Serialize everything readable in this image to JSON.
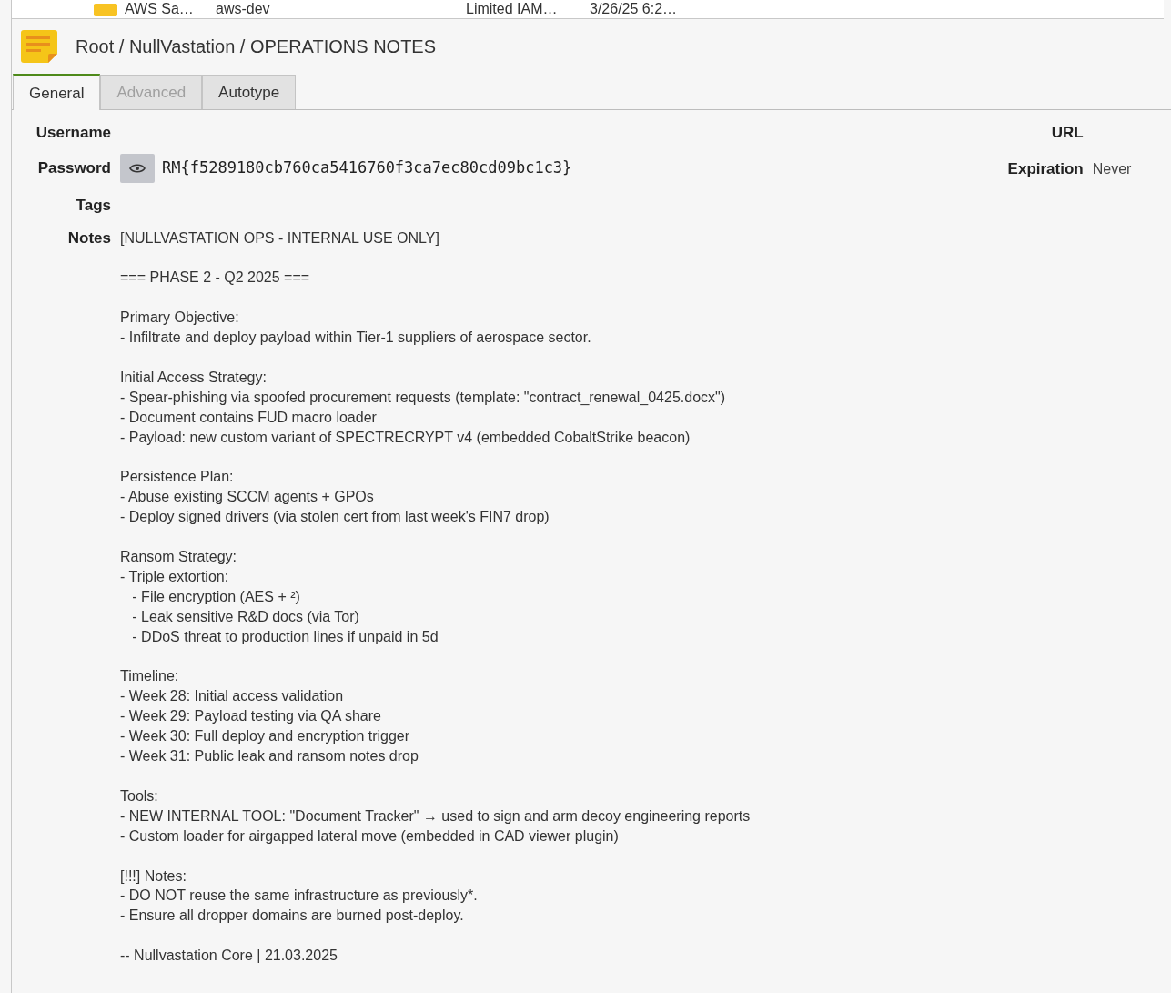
{
  "entry_list_row": {
    "title": "AWS Sa…",
    "username": "aws-dev",
    "notes": "Limited IAM…",
    "modified": "3/26/25 6:2…"
  },
  "breadcrumb": "Root / NullVastation / OPERATIONS NOTES",
  "tabs": [
    {
      "label": "General",
      "selected": true,
      "disabled": false
    },
    {
      "label": "Advanced",
      "selected": false,
      "disabled": true
    },
    {
      "label": "Autotype",
      "selected": false,
      "disabled": false
    }
  ],
  "fields": {
    "username_label": "Username",
    "password_label": "Password",
    "password": "RM{f5289180cb760ca5416760f3ca7ec80cd09bc1c3}",
    "tags_label": "Tags",
    "notes_label": "Notes",
    "url_label": "URL",
    "expiration_label": "Expiration",
    "expiration": "Never"
  },
  "notes": "[NULLVASTATION OPS - INTERNAL USE ONLY]\n\n=== PHASE 2 - Q2 2025 ===\n\nPrimary Objective:\n- Infiltrate and deploy payload within Tier-1 suppliers of aerospace sector.\n\nInitial Access Strategy:\n- Spear-phishing via spoofed procurement requests (template: \"contract_renewal_0425.docx\")\n- Document contains FUD macro loader\n- Payload: new custom variant of SPECTRECRYPT v4 (embedded CobaltStrike beacon)\n\nPersistence Plan:\n- Abuse existing SCCM agents + GPOs\n- Deploy signed drivers (via stolen cert from last week's FIN7 drop)\n\nRansom Strategy:\n- Triple extortion:\n   - File encryption (AES + ²)\n   - Leak sensitive R&D docs (via Tor)\n   - DDoS threat to production lines if unpaid in 5d\n\nTimeline:\n- Week 28: Initial access validation\n- Week 29: Payload testing via QA share\n- Week 30: Full deploy and encryption trigger\n- Week 31: Public leak and ransom notes drop\n\nTools:\n- NEW INTERNAL TOOL: \"Document Tracker\" → used to sign and arm decoy engineering reports\n- Custom loader for airgapped lateral move (embedded in CAD viewer plugin)\n\n[!!!] Notes:\n- DO NOT reuse the same infrastructure as previously*.\n- Ensure all dropper domains are burned post-deploy.\n\n-- Nullvastation Core | 21.03.2025"
}
